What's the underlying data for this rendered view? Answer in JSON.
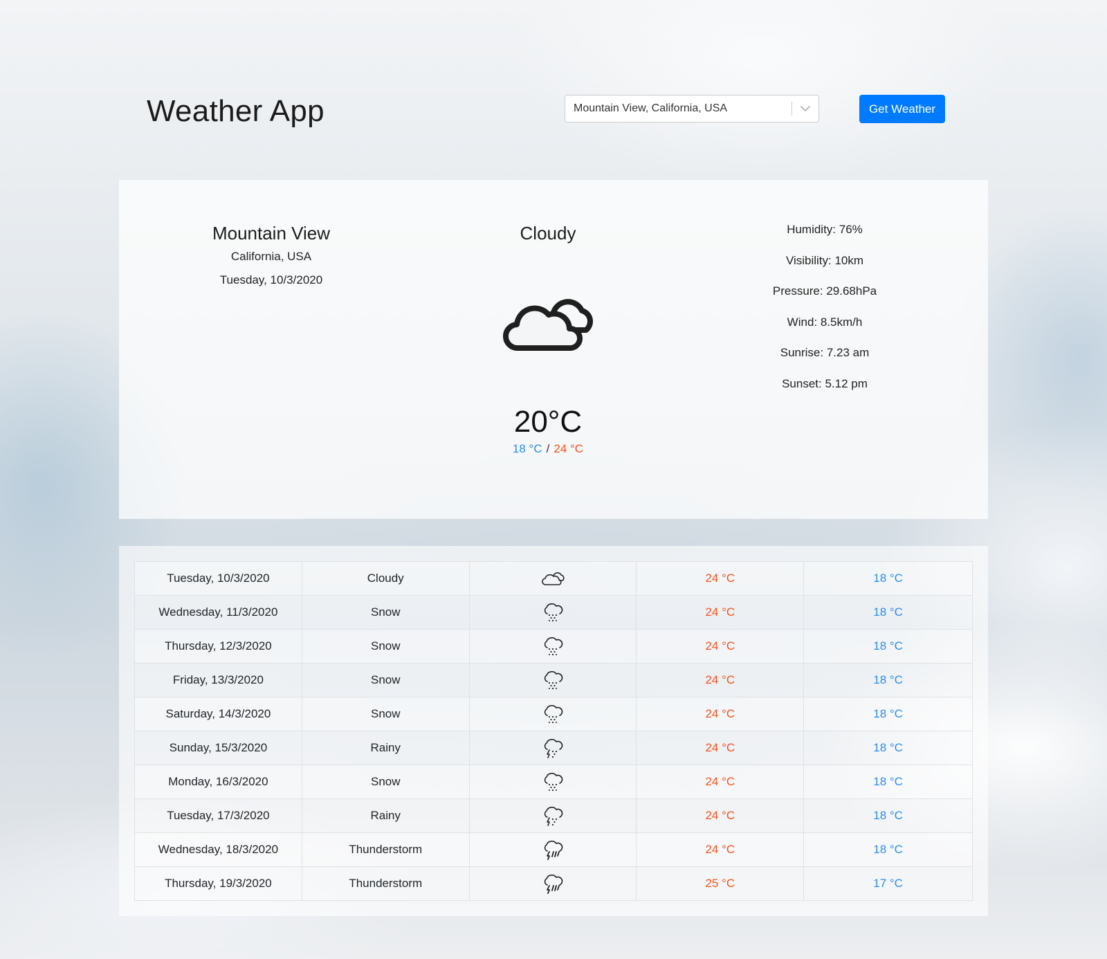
{
  "app": {
    "title": "Weather App"
  },
  "search": {
    "selected": "Mountain View, California, USA",
    "button_label": "Get Weather"
  },
  "current": {
    "city": "Mountain View",
    "region": "California, USA",
    "date": "Tuesday, 10/3/2020",
    "condition": "Cloudy",
    "icon": "cloudy-icon",
    "temperature": "20°C",
    "min": "18 °C",
    "separator": "/",
    "max": "24 °C",
    "details": [
      "Humidity: 76%",
      "Visibility: 10km",
      "Pressure: 29.68hPa",
      "Wind: 8.5km/h",
      "Sunrise: 7.23 am",
      "Sunset: 5.12 pm"
    ]
  },
  "forecast": [
    {
      "date": "Tuesday, 10/3/2020",
      "condition": "Cloudy",
      "icon": "cloudy",
      "max": "24 °C",
      "min": "18 °C"
    },
    {
      "date": "Wednesday, 11/3/2020",
      "condition": "Snow",
      "icon": "snow",
      "max": "24 °C",
      "min": "18 °C"
    },
    {
      "date": "Thursday, 12/3/2020",
      "condition": "Snow",
      "icon": "snow",
      "max": "24 °C",
      "min": "18 °C"
    },
    {
      "date": "Friday, 13/3/2020",
      "condition": "Snow",
      "icon": "snow",
      "max": "24 °C",
      "min": "18 °C"
    },
    {
      "date": "Saturday, 14/3/2020",
      "condition": "Snow",
      "icon": "snow",
      "max": "24 °C",
      "min": "18 °C"
    },
    {
      "date": "Sunday, 15/3/2020",
      "condition": "Rainy",
      "icon": "rain",
      "max": "24 °C",
      "min": "18 °C"
    },
    {
      "date": "Monday, 16/3/2020",
      "condition": "Snow",
      "icon": "snow",
      "max": "24 °C",
      "min": "18 °C"
    },
    {
      "date": "Tuesday, 17/3/2020",
      "condition": "Rainy",
      "icon": "rain",
      "max": "24 °C",
      "min": "18 °C"
    },
    {
      "date": "Wednesday, 18/3/2020",
      "condition": "Thunderstorm",
      "icon": "thunderstorm",
      "max": "24 °C",
      "min": "18 °C"
    },
    {
      "date": "Thursday, 19/3/2020",
      "condition": "Thunderstorm",
      "icon": "thunderstorm",
      "max": "25 °C",
      "min": "17 °C"
    }
  ],
  "colors": {
    "accent": "#007bff",
    "max_temp": "#f4511e",
    "min_temp": "#2d8cf0"
  }
}
